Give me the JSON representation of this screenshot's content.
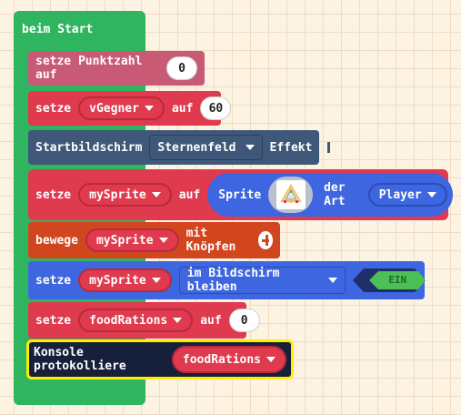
{
  "colors": {
    "event": "#2fb460",
    "variables": "#e03a4e",
    "variables_top": "#c95a76",
    "scene": "#3f5879",
    "sprites": "#3e66e0",
    "controller": "#d2461f",
    "console_bg": "#16203a",
    "highlight": "#ffee00",
    "ein": "#4cbf56"
  },
  "blocks": {
    "start": {
      "label": "beim Start"
    },
    "score": {
      "label": "setze Punktzahl auf",
      "value": "0"
    },
    "enemy": {
      "label": "setze",
      "var": "vGegner",
      "mid": "auf",
      "value": "60"
    },
    "splash": {
      "label": "Startbildschirm",
      "effect": "Sternenfeld",
      "tail": "Effekt",
      "plus_icon": "plus-icon"
    },
    "sprite": {
      "label": "setze",
      "var": "mySprite",
      "mid": "auf",
      "sprite_label": "Sprite",
      "sprite_icon": "sprite-thumbnail-icon",
      "kind_label": "der Art",
      "kind": "Player"
    },
    "move": {
      "label": "bewege",
      "var": "mySprite",
      "tail": "mit Knöpfen",
      "plus_icon": "plus-icon"
    },
    "flag": {
      "label": "setze",
      "var": "mySprite",
      "flag": "im Bildschirm bleiben",
      "toggle": "EIN"
    },
    "food": {
      "label": "setze",
      "var": "foodRations",
      "mid": "auf",
      "value": "0"
    },
    "log": {
      "label": "Konsole protokolliere",
      "var": "foodRations"
    }
  }
}
